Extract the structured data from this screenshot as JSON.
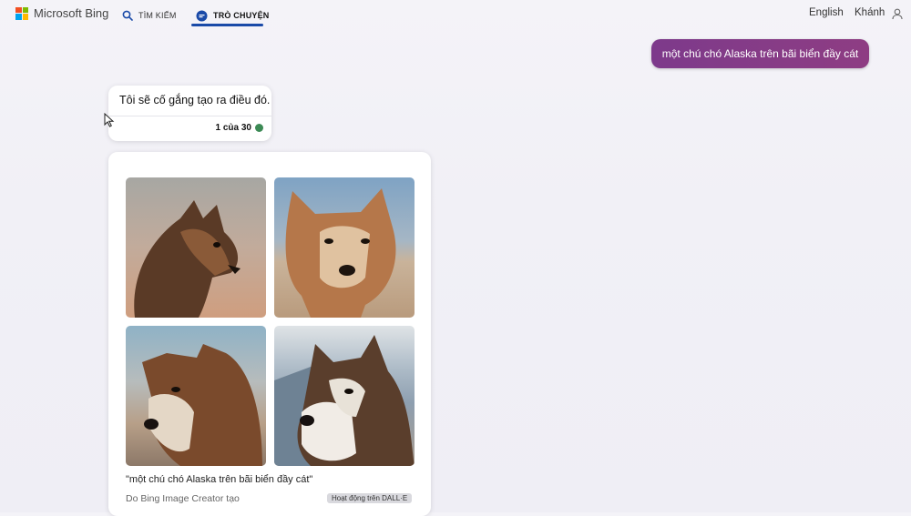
{
  "header": {
    "brand": "Microsoft Bing",
    "tabs": [
      {
        "label": "TÌM KIẾM",
        "icon": "search-icon"
      },
      {
        "label": "TRÒ CHUYỆN",
        "icon": "chat-icon",
        "active": true
      }
    ],
    "language": "English",
    "user_name": "Khánh",
    "accent": "#1a4aa8"
  },
  "conversation": {
    "user_message": "một chú chó Alaska trên bãi biển đầy cát",
    "bot_reply": "Tôi sẽ cố gắng tạo ra điều đó.",
    "counter": "1 của 30",
    "status_color": "#3c8a55"
  },
  "image_result": {
    "caption": "\"một chú chó Alaska trên bãi biển đầy cát\"",
    "creator": "Do Bing Image Creator tạo",
    "badge": "Hoạt động trên DALL·E",
    "images": [
      "alaska-dog-1",
      "alaska-dog-2",
      "alaska-dog-3",
      "alaska-dog-4"
    ]
  }
}
